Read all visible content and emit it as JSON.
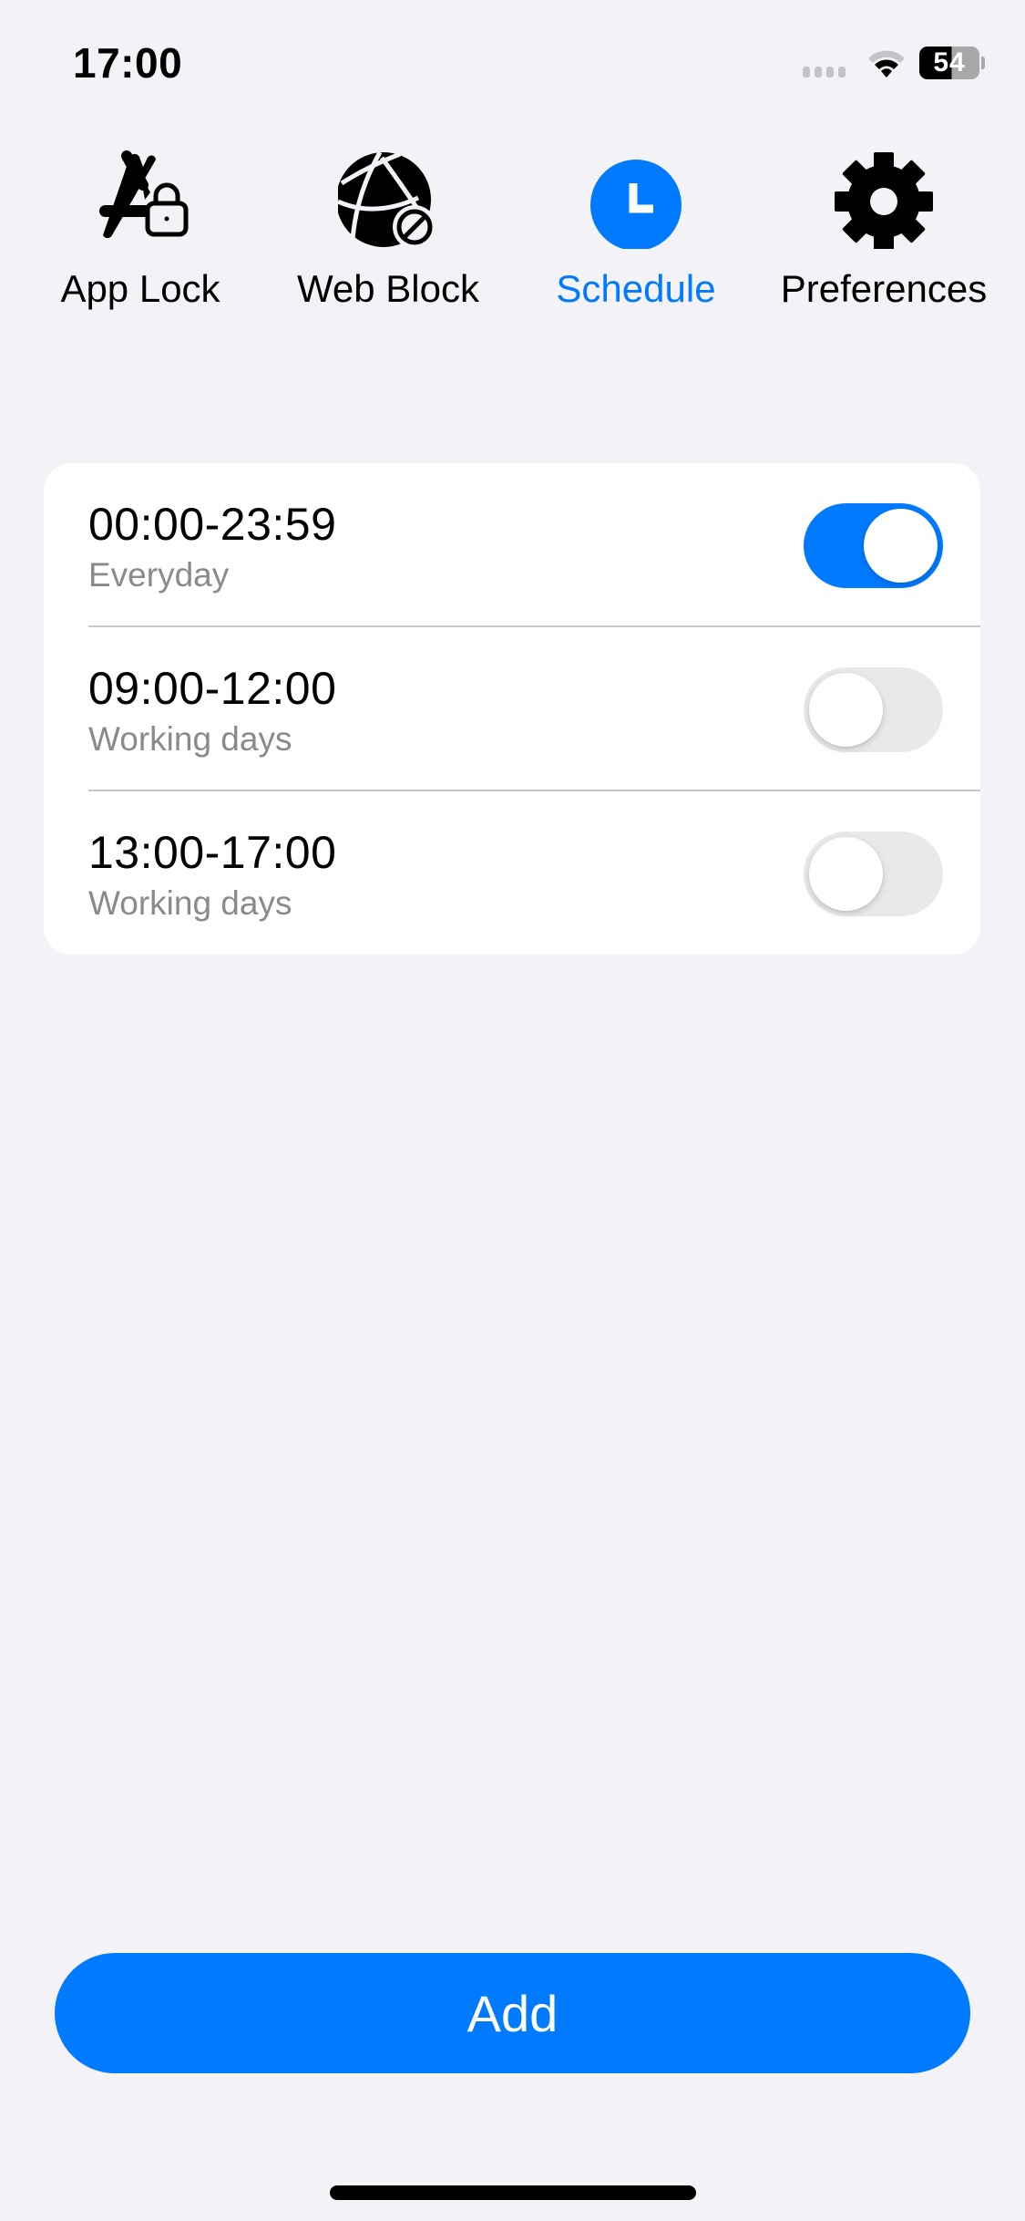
{
  "status_bar": {
    "time": "17:00",
    "battery_level": "54",
    "icons": [
      "cellular-signal-icon",
      "wifi-icon",
      "battery-icon"
    ]
  },
  "tabs": [
    {
      "id": "app-lock",
      "label": "App Lock",
      "icon": "app-lock-icon",
      "active": false
    },
    {
      "id": "web-block",
      "label": "Web Block",
      "icon": "web-block-icon",
      "active": false
    },
    {
      "id": "schedule",
      "label": "Schedule",
      "icon": "clock-icon",
      "active": true
    },
    {
      "id": "preferences",
      "label": "Preferences",
      "icon": "gear-icon",
      "active": false
    }
  ],
  "schedules": [
    {
      "time_range": "00:00-23:59",
      "repeat": "Everyday",
      "enabled": true
    },
    {
      "time_range": "09:00-12:00",
      "repeat": "Working days",
      "enabled": false
    },
    {
      "time_range": "13:00-17:00",
      "repeat": "Working days",
      "enabled": false
    }
  ],
  "add_button": {
    "label": "Add"
  },
  "colors": {
    "accent": "#007aff",
    "background": "#f2f2f7",
    "card": "#ffffff",
    "secondary_text": "#8a8a8e",
    "toggle_off": "#e9e9eb"
  }
}
